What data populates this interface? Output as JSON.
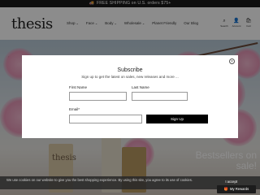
{
  "promo": {
    "text": "FREE SHIPPING on U.S. orders $75+"
  },
  "header": {
    "logo": "thesis",
    "nav": [
      {
        "label": "Shop",
        "has_dropdown": true
      },
      {
        "label": "Face",
        "has_dropdown": true
      },
      {
        "label": "Body",
        "has_dropdown": true
      },
      {
        "label": "Wholesale",
        "has_dropdown": true
      },
      {
        "label": "Planet Friendly",
        "has_dropdown": false
      },
      {
        "label": "Our Blog",
        "has_dropdown": false
      }
    ],
    "icons": [
      {
        "name": "search-icon",
        "glyph": "⌕",
        "label": "Search"
      },
      {
        "name": "account-icon",
        "glyph": "👤",
        "label": "Account"
      },
      {
        "name": "cart-icon",
        "glyph": "🛍",
        "label": "Cart"
      }
    ]
  },
  "hero": {
    "brand": "thesis",
    "headline": "Bestsellers on sale!"
  },
  "modal": {
    "close_glyph": "×",
    "title": "Subscribe",
    "subtitle": "Sign up to get the latest on sales, new releases and more ...",
    "first_name_label": "First Name",
    "last_name_label": "Last Name",
    "email_label": "Email*",
    "submit_label": "Sign Up",
    "first_name_value": "",
    "last_name_value": "",
    "email_value": ""
  },
  "cookie": {
    "text": "We use cookies on our website to give you the best shopping experience. By using this site, you agree to its use of cookies.",
    "accept": "I accept"
  },
  "rewards": {
    "label": "My Rewards",
    "icon": "gift-icon"
  },
  "colors": {
    "overlay": "rgba(0,0,0,0.45)",
    "button": "#000000",
    "promo_bg": "#1a1a1a"
  }
}
